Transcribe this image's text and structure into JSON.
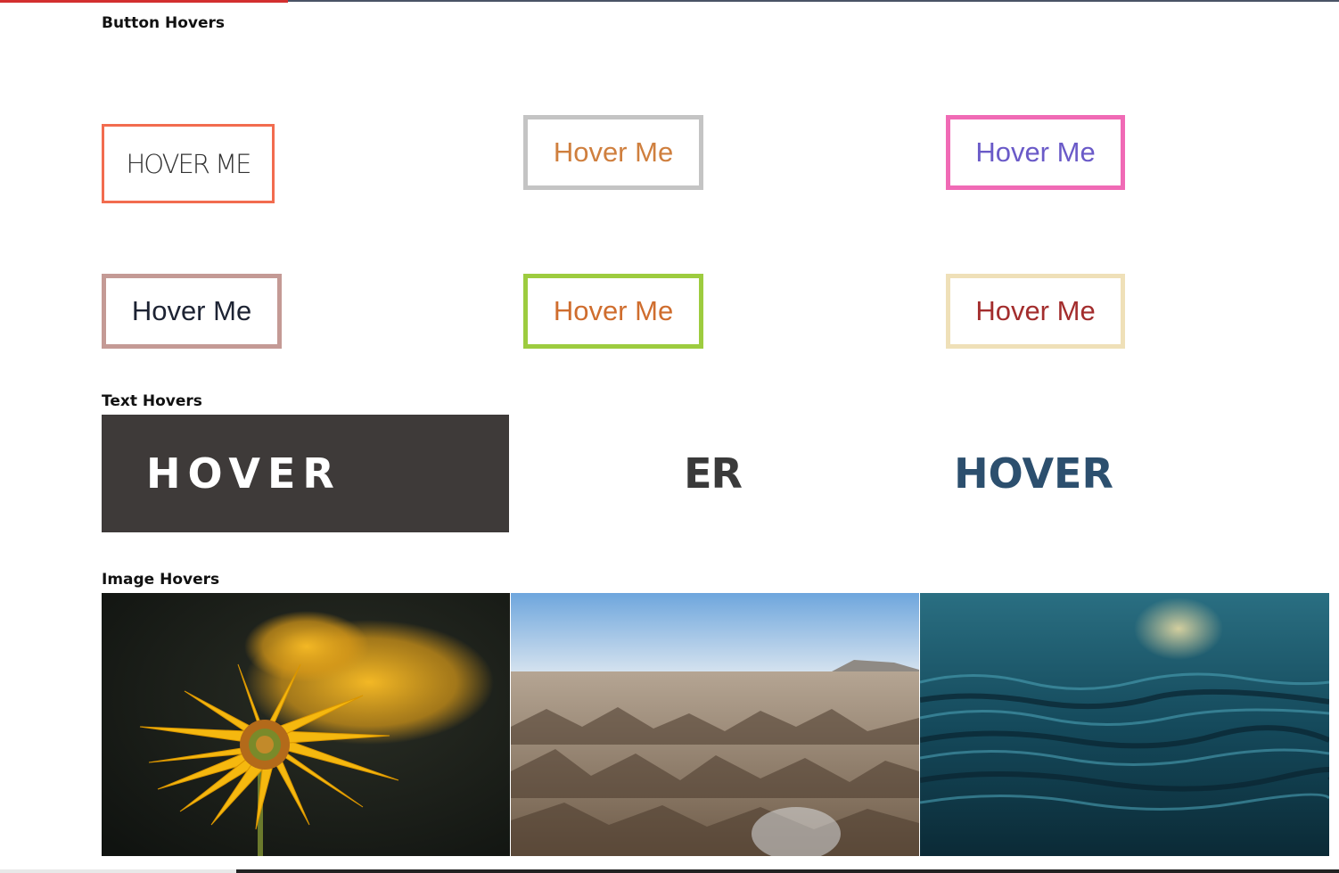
{
  "sections": {
    "button_hovers_title": "Button Hovers",
    "text_hovers_title": "Text Hovers",
    "image_hovers_title": "Image Hovers"
  },
  "buttons": [
    {
      "label": "HOVER ME"
    },
    {
      "label": "Hover Me"
    },
    {
      "label": "Hover Me"
    },
    {
      "label": "Hover Me"
    },
    {
      "label": "Hover Me"
    },
    {
      "label": "Hover Me"
    }
  ],
  "text_hovers": [
    {
      "text": "HOVER"
    },
    {
      "text": "ER"
    },
    {
      "text": "HOVER"
    }
  ],
  "images": [
    {
      "subject": "yellow flower"
    },
    {
      "subject": "desert badlands landscape"
    },
    {
      "subject": "ocean water waves"
    }
  ],
  "colors": {
    "progress_bar": "#d32f2f",
    "dark_block": "#3e3a39",
    "btn1_border": "#f26c4f",
    "btn2_border": "#c4c4c4",
    "btn3_border": "#f06ab5",
    "btn4_border": "#c49a95",
    "btn5_border": "#9dcc3f",
    "btn6_border": "#efe0b8"
  }
}
